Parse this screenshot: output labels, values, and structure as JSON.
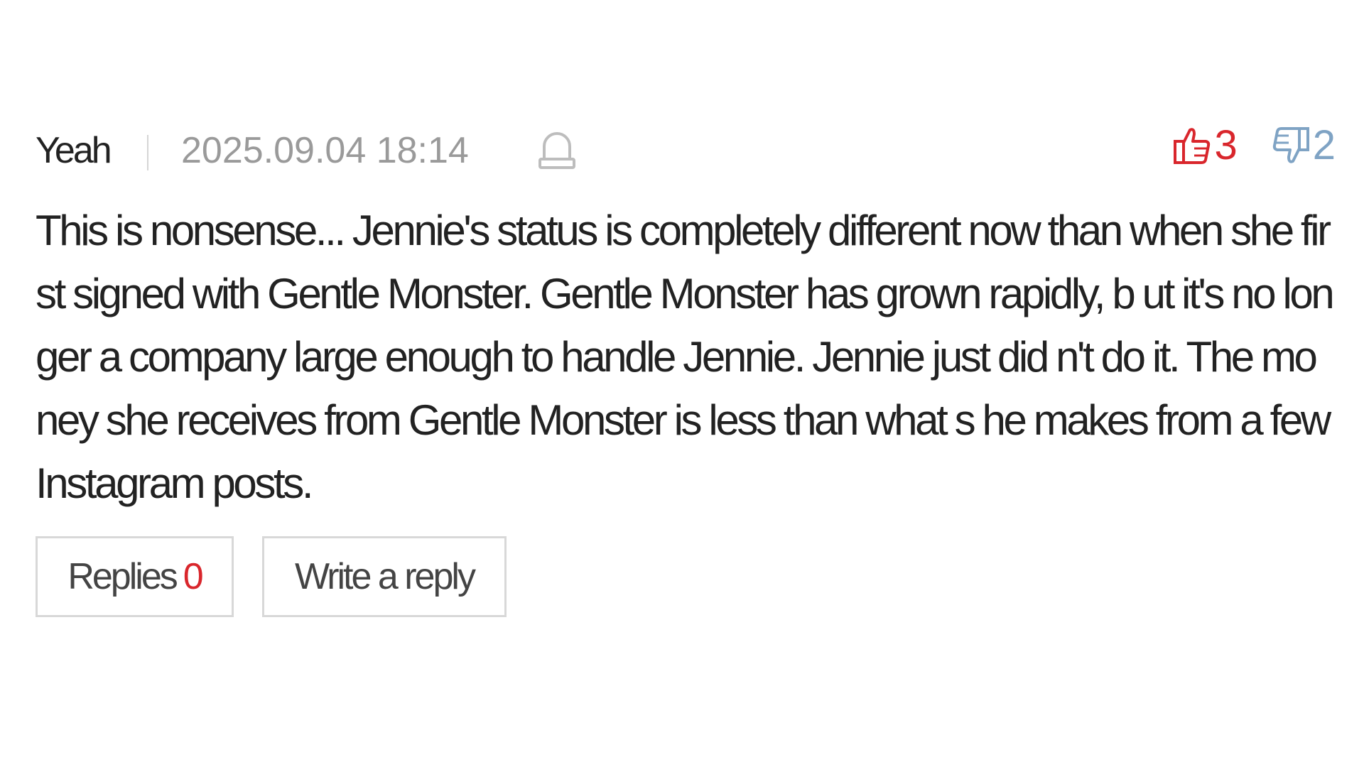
{
  "comment": {
    "author": "Yeah",
    "datetime": "2025.09.04 18:14",
    "report_icon": "bell-icon",
    "likes": {
      "icon": "thumbs-up-icon",
      "count": "3",
      "color": "#d9262c"
    },
    "dislikes": {
      "icon": "thumbs-down-icon",
      "count": "2",
      "color": "#7fa3c4"
    },
    "text": "This is nonsense... Jennie's status is completely different now than when she first signed with Gentle Monster. Gentle Monster has grown rapidly, b ut it's no longer a company large enough to handle Jennie. Jennie just did n't do it. The money she receives from Gentle Monster is less than what s he makes from a few Instagram posts.",
    "actions": {
      "replies_label": "Replies",
      "replies_count": "0",
      "write_reply_label": "Write a reply"
    }
  }
}
